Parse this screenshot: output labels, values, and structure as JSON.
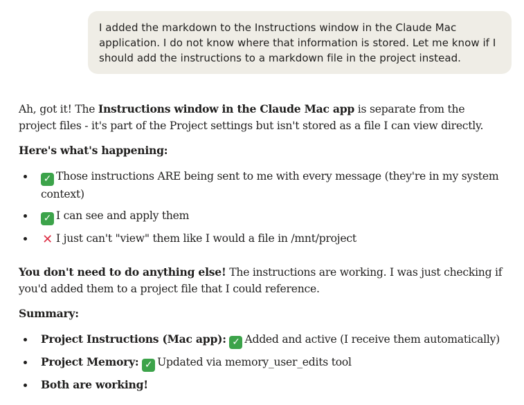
{
  "user_message": {
    "text": "I added the markdown to the Instructions window in the Claude Mac application. I do not know where that information is stored. Let me know if I should add the instructions to a markdown file in the project instead."
  },
  "assistant_message": {
    "intro": {
      "prefix": "Ah, got it! The ",
      "bold": "Instructions window in the Claude Mac app",
      "suffix": " is separate from the project files - it's part of the Project settings but isn't stored as a file I can view directly."
    },
    "happening_heading": "Here's what's happening:",
    "happening_items": [
      {
        "icon": "check-mark-icon",
        "text": "Those instructions ARE being sent to me with every message (they're in my system context)"
      },
      {
        "icon": "check-mark-icon",
        "text": "I can see and apply them"
      },
      {
        "icon": "cross-mark-icon",
        "text": "I just can't \"view\" them like I would a file in /mnt/project"
      }
    ],
    "no_action": {
      "bold": "You don't need to do anything else!",
      "text": " The instructions are working. I was just checking if you'd added them to a project file that I could reference."
    },
    "summary_heading": "Summary:",
    "summary_items": [
      {
        "bold": "Project Instructions (Mac app):",
        "icon": "check-mark-icon",
        "text": "Added and active (I receive them automatically)"
      },
      {
        "bold": "Project Memory:",
        "icon": "check-mark-icon",
        "text": "Updated via memory_user_edits tool"
      },
      {
        "bold": "Both are working!",
        "text": ""
      }
    ]
  },
  "colors": {
    "user_bubble_bg": "#efede6",
    "text": "#1f1e1d",
    "check_green": "#3ca34a",
    "cross_red": "#dd2e44"
  }
}
